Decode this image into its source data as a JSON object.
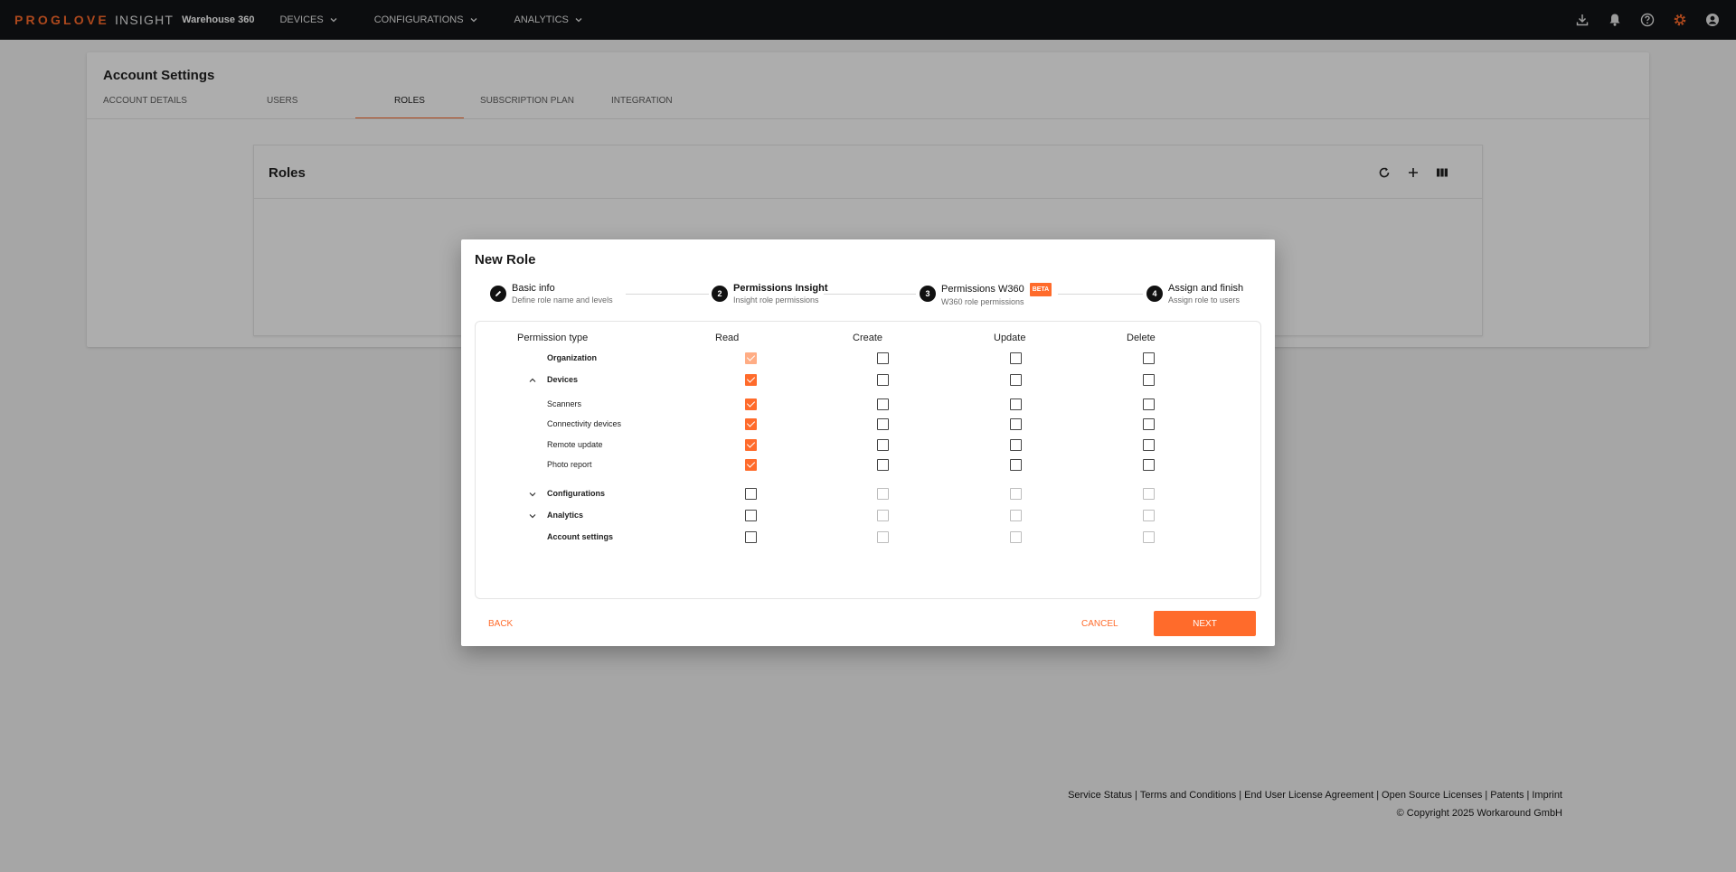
{
  "topbar": {
    "brand_primary": "PROGLOVE",
    "brand_secondary": "INSIGHT",
    "workspace": "Warehouse 360",
    "nav": [
      "DEVICES",
      "CONFIGURATIONS",
      "ANALYTICS"
    ],
    "icons": [
      "download-icon",
      "bell-icon",
      "help-icon",
      "settings-icon",
      "account-icon"
    ],
    "accent_color": "#ff6b2b"
  },
  "page": {
    "title": "Account Settings",
    "tabs": [
      "ACCOUNT DETAILS",
      "USERS",
      "ROLES",
      "SUBSCRIPTION PLAN",
      "INTEGRATION"
    ],
    "active_tab": "ROLES",
    "roles_title": "Roles",
    "roles_icons": [
      "refresh-icon",
      "add-icon",
      "columns-icon"
    ]
  },
  "footer": {
    "links": [
      "Service Status",
      "Terms and Conditions",
      "End User License Agreement",
      "Open Source Licenses",
      "Patents",
      "Imprint"
    ],
    "separator": "|",
    "copyright": "© Copyright 2025 Workaround GmbH"
  },
  "modal": {
    "title": "New Role",
    "steps": [
      {
        "title": "Basic info",
        "subtitle": "Define role name and levels",
        "marker": "edit-icon"
      },
      {
        "title": "Permissions Insight",
        "subtitle": "Insight role permissions",
        "marker": "2"
      },
      {
        "title": "Permissions W360",
        "subtitle": "W360 role permissions",
        "marker": "3",
        "badge": "BETA"
      },
      {
        "title": "Assign and finish",
        "subtitle": "Assign role to users",
        "marker": "4"
      }
    ],
    "active_step": 2,
    "table": {
      "headers": [
        "Permission type",
        "Read",
        "Create",
        "Update",
        "Delete"
      ],
      "rows": [
        {
          "label": "Organization",
          "bold": true,
          "chevron": null,
          "read": true,
          "read_disabled": true,
          "create": false,
          "update": false,
          "delete": false,
          "others_disabled": false
        },
        {
          "label": "Devices",
          "bold": true,
          "chevron": "up",
          "read": true,
          "read_disabled": false,
          "create": false,
          "update": false,
          "delete": false,
          "others_disabled": false
        },
        {
          "label": "Scanners",
          "bold": false,
          "chevron": null,
          "read": true,
          "read_disabled": false,
          "create": false,
          "update": false,
          "delete": false,
          "others_disabled": false
        },
        {
          "label": "Connectivity devices",
          "bold": false,
          "chevron": null,
          "read": true,
          "read_disabled": false,
          "create": false,
          "update": false,
          "delete": false,
          "others_disabled": false
        },
        {
          "label": "Remote update",
          "bold": false,
          "chevron": null,
          "read": true,
          "read_disabled": false,
          "create": false,
          "update": false,
          "delete": false,
          "others_disabled": false
        },
        {
          "label": "Photo report",
          "bold": false,
          "chevron": null,
          "read": true,
          "read_disabled": false,
          "create": false,
          "update": false,
          "delete": false,
          "others_disabled": false
        },
        {
          "label": "Configurations",
          "bold": true,
          "chevron": "down",
          "read": false,
          "read_disabled": false,
          "create": false,
          "update": false,
          "delete": false,
          "others_disabled": true
        },
        {
          "label": "Analytics",
          "bold": true,
          "chevron": "down",
          "read": false,
          "read_disabled": false,
          "create": false,
          "update": false,
          "delete": false,
          "others_disabled": true
        },
        {
          "label": "Account settings",
          "bold": true,
          "chevron": null,
          "read": false,
          "read_disabled": false,
          "create": false,
          "update": false,
          "delete": false,
          "others_disabled": true
        }
      ]
    },
    "buttons": {
      "back": "BACK",
      "cancel": "CANCEL",
      "next": "NEXT"
    }
  }
}
